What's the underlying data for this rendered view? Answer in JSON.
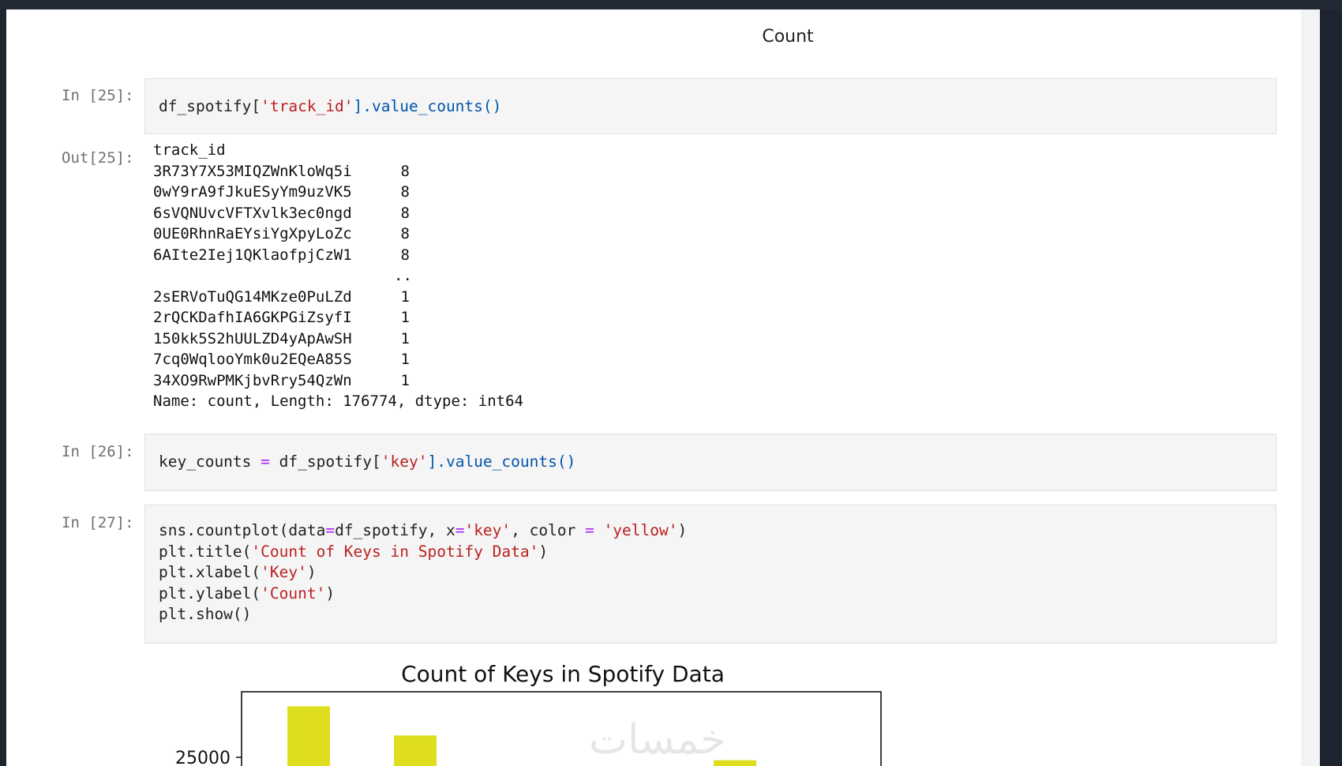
{
  "header": {
    "title": "Count"
  },
  "cells": [
    {
      "prompt": "In [25]:"
    },
    {
      "prompt": "Out[25]:"
    },
    {
      "prompt": "In [26]:"
    },
    {
      "prompt": "In [27]:"
    }
  ],
  "code": {
    "c25": {
      "a": "df_spotify[",
      "b": "'track_id'",
      "c": "].value_counts()"
    },
    "c26": {
      "a": "key_counts ",
      "eq": "=",
      "b": " df_spotify[",
      "c": "'key'",
      "d": "].value_counts()"
    },
    "c27": {
      "l1a": "sns.countplot(data",
      "l1eq": "=",
      "l1b": "df_spotify, x",
      "l1eq2": "=",
      "l1s": "'key'",
      "l1c": ", color ",
      "l1eq3": "=",
      "l1s2": " 'yellow'",
      "l1d": ")",
      "l2a": "plt.title(",
      "l2s": "'Count of Keys in Spotify Data'",
      "l2b": ")",
      "l3a": "plt.xlabel(",
      "l3s": "'Key'",
      "l3b": ")",
      "l4a": "plt.ylabel(",
      "l4s": "'Count'",
      "l4b": ")",
      "l5a": "plt.show()"
    }
  },
  "output": {
    "header": "track_id",
    "top_rows": [
      {
        "id": "3R73Y7X53MIQZWnKloWq5i",
        "count": "8"
      },
      {
        "id": "0wY9rA9fJkuESyYm9uzVK5",
        "count": "8"
      },
      {
        "id": "6sVQNUvcVFTXvlk3ec0ngd",
        "count": "8"
      },
      {
        "id": "0UE0RhnRaEYsiYgXpyLoZc",
        "count": "8"
      },
      {
        "id": "6AIte2Iej1QKlaofpjCzW1",
        "count": "8"
      }
    ],
    "ellipsis": "..",
    "bottom_rows": [
      {
        "id": "2sERVoTuQG14MKze0PuLZd",
        "count": "1"
      },
      {
        "id": "2rQCKDafhIA6GKPGiZsyfI",
        "count": "1"
      },
      {
        "id": "150kk5S2hUULZD4yApAwSH",
        "count": "1"
      },
      {
        "id": "7cq0WqlooYmk0u2EQeA85S",
        "count": "1"
      },
      {
        "id": "34XO9RwPMKjbvRry54QzWn",
        "count": "1"
      }
    ],
    "footer": "Name: count, Length: 176774, dtype: int64"
  },
  "chart_data": {
    "type": "bar",
    "title": "Count of Keys in Spotify Data",
    "color": "#dede1e",
    "ytick_labels": [
      "25000"
    ],
    "visible_bar_tops": [
      28500,
      26500,
      0,
      0,
      24800
    ],
    "visible_y_range": [
      22700,
      29500
    ]
  },
  "watermark": "خمسات"
}
